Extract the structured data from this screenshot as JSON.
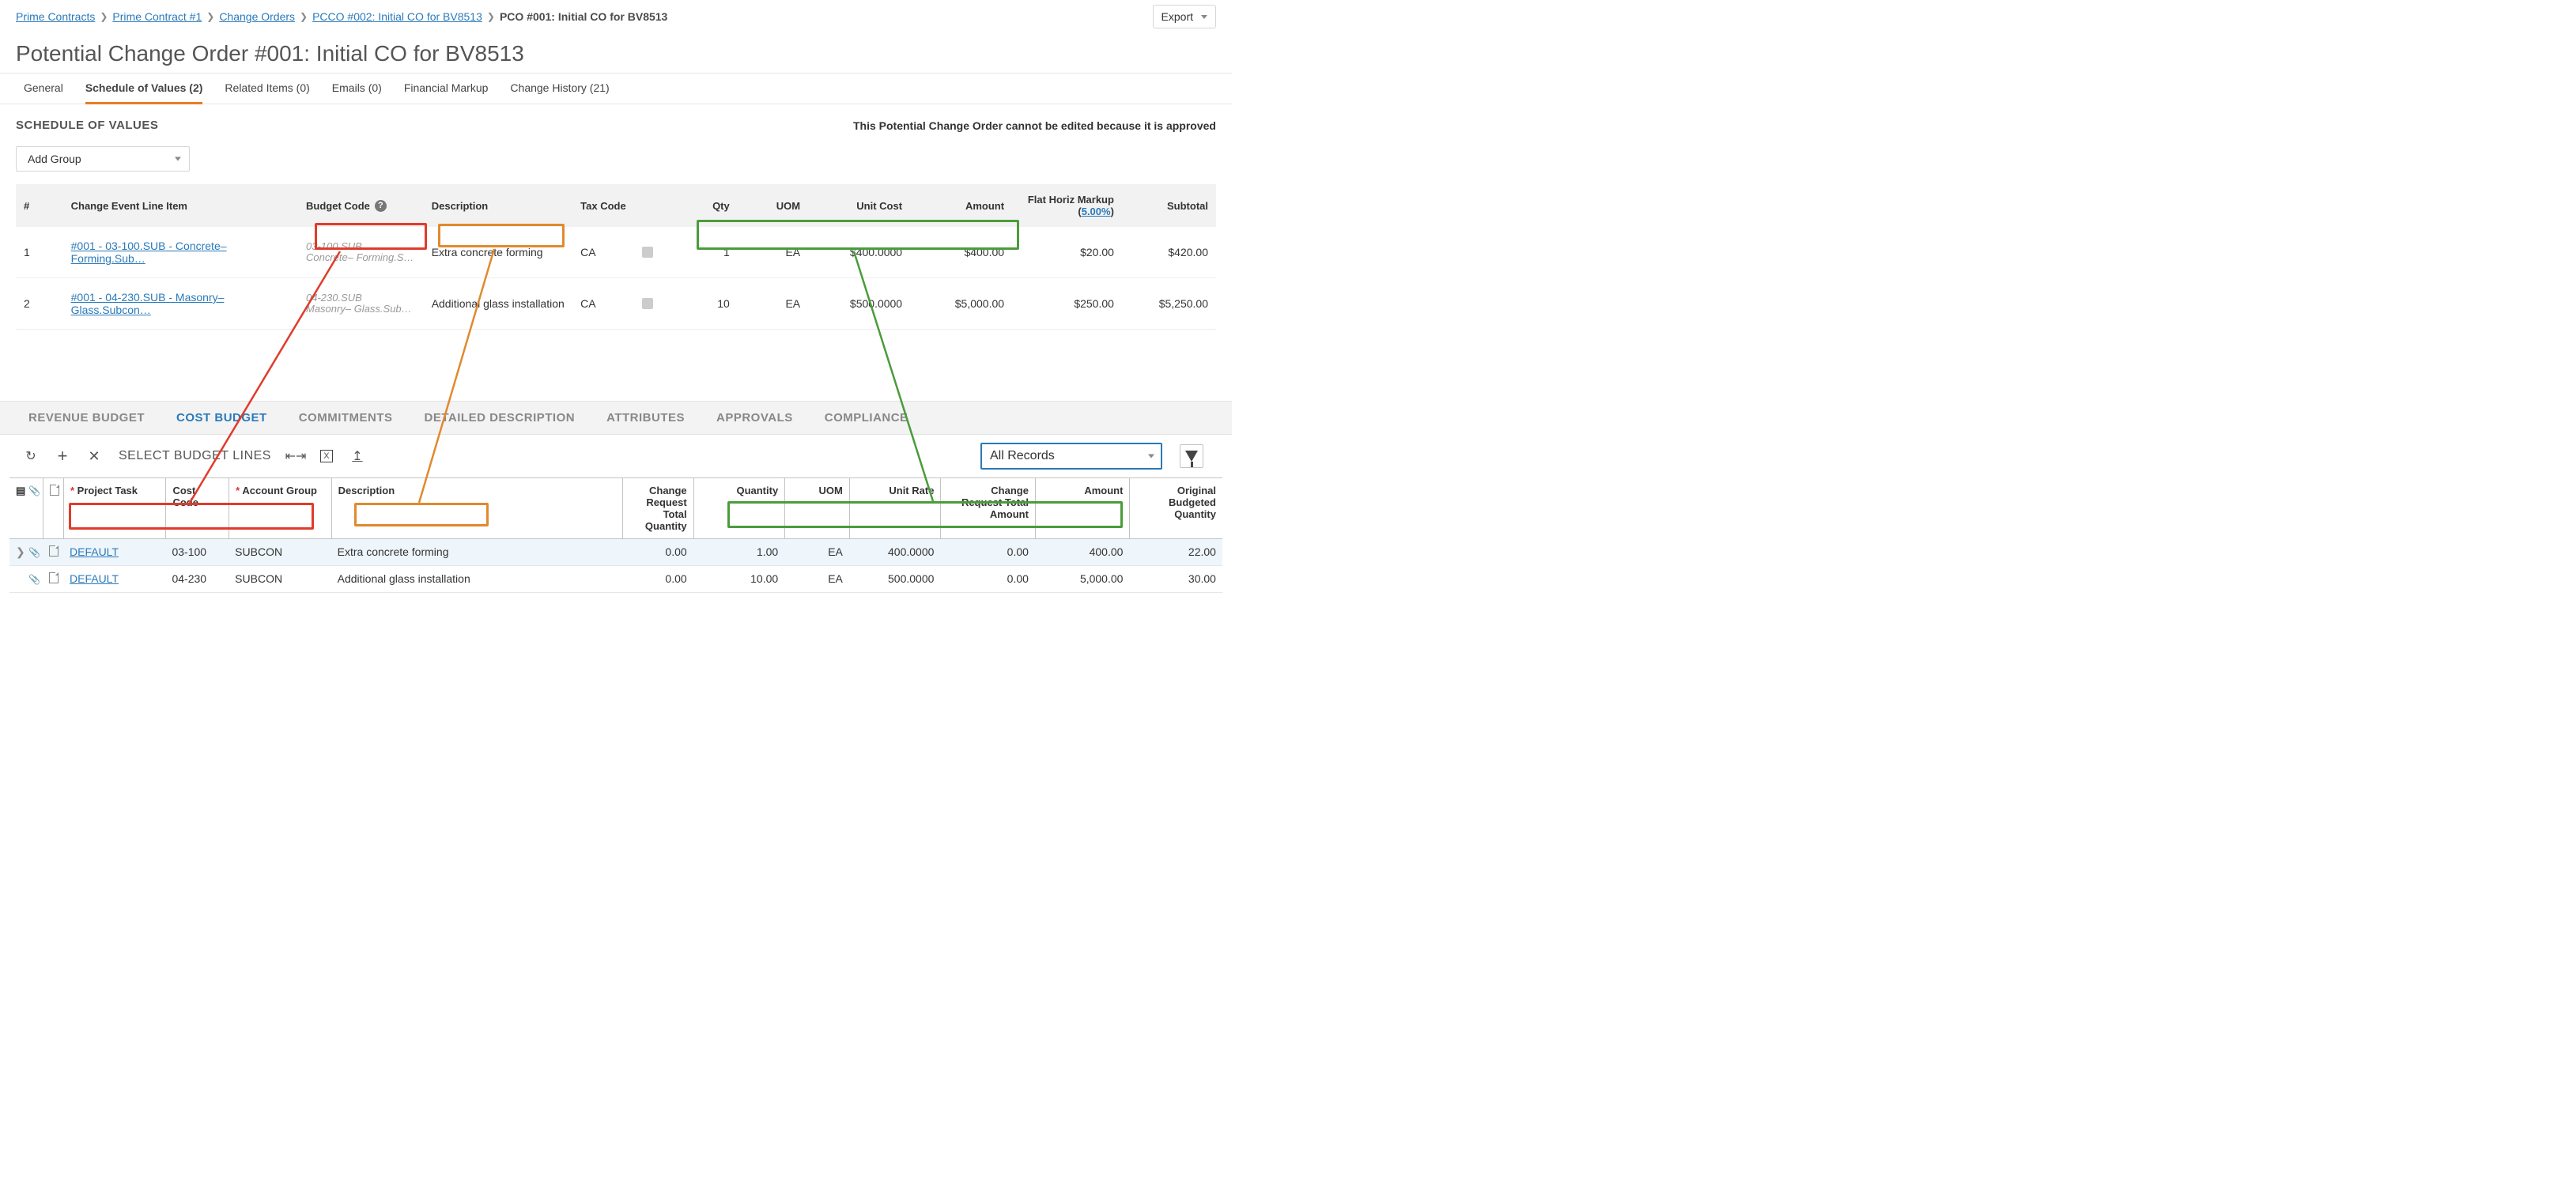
{
  "breadcrumbs": [
    "Prime Contracts",
    "Prime Contract #1",
    "Change Orders",
    "PCCO #002: Initial CO for BV8513",
    "PCO #001: Initial CO for BV8513"
  ],
  "export_label": "Export",
  "page_title": "Potential Change Order #001: Initial CO for BV8513",
  "tabs": {
    "general": "General",
    "sov": "Schedule of Values (2)",
    "related": "Related Items (0)",
    "emails": "Emails (0)",
    "markup": "Financial Markup",
    "history": "Change History (21)"
  },
  "section_title": "SCHEDULE OF VALUES",
  "locked_note": "This Potential Change Order cannot be edited because it is approved",
  "add_group_label": "Add Group",
  "sov_headers": {
    "num": "#",
    "cle": "Change Event Line Item",
    "budget_code": "Budget Code",
    "desc": "Description",
    "tax": "Tax Code",
    "qty": "Qty",
    "uom": "UOM",
    "unit_cost": "Unit Cost",
    "amount": "Amount",
    "fhm_label": "Flat Horiz Markup",
    "fhm_pct": "5.00%",
    "subtotal": "Subtotal"
  },
  "sov_rows": [
    {
      "num": "1",
      "cle": "#001 - 03-100.SUB - Concrete– Forming.Sub…",
      "bc1": "03-100.SUB",
      "bc2": "Concrete– Forming.S…",
      "desc": "Extra concrete forming",
      "tax": "CA",
      "qty": "1",
      "uom": "EA",
      "unit_cost": "$400.0000",
      "amount": "$400.00",
      "fhm": "$20.00",
      "subtotal": "$420.00"
    },
    {
      "num": "2",
      "cle": "#001 - 04-230.SUB - Masonry– Glass.Subcon…",
      "bc1": "04-230.SUB",
      "bc2": "Masonry– Glass.Sub…",
      "desc": "Additional glass installation",
      "tax": "CA",
      "qty": "10",
      "uom": "EA",
      "unit_cost": "$500.0000",
      "amount": "$5,000.00",
      "fhm": "$250.00",
      "subtotal": "$5,250.00"
    }
  ],
  "lower_tabs": {
    "rev": "REVENUE BUDGET",
    "cost": "COST BUDGET",
    "commit": "COMMITMENTS",
    "detail": "DETAILED DESCRIPTION",
    "attr": "ATTRIBUTES",
    "appr": "APPROVALS",
    "comp": "COMPLIANCE"
  },
  "select_budget_lines": "SELECT BUDGET LINES",
  "record_filter": "All Records",
  "grid_headers": {
    "project_task": "Project Task",
    "cost_code": "Cost Code",
    "acct_group": "Account Group",
    "desc": "Description",
    "crtq": "Change Request Total Quantity",
    "qty": "Quantity",
    "uom": "UOM",
    "unit_rate": "Unit Rate",
    "crta": "Change Request Total Amount",
    "amount": "Amount",
    "obq": "Original Budgeted Quantity"
  },
  "grid_rows": [
    {
      "project_task": "DEFAULT",
      "cost_code": "03-100",
      "acct_group": "SUBCON",
      "desc": "Extra concrete forming",
      "crtq": "0.00",
      "qty": "1.00",
      "uom": "EA",
      "unit_rate": "400.0000",
      "crta": "0.00",
      "amount": "400.00",
      "obq": "22.00"
    },
    {
      "project_task": "DEFAULT",
      "cost_code": "04-230",
      "acct_group": "SUBCON",
      "desc": "Additional glass installation",
      "crtq": "0.00",
      "qty": "10.00",
      "uom": "EA",
      "unit_rate": "500.0000",
      "crta": "0.00",
      "amount": "5,000.00",
      "obq": "30.00"
    }
  ]
}
